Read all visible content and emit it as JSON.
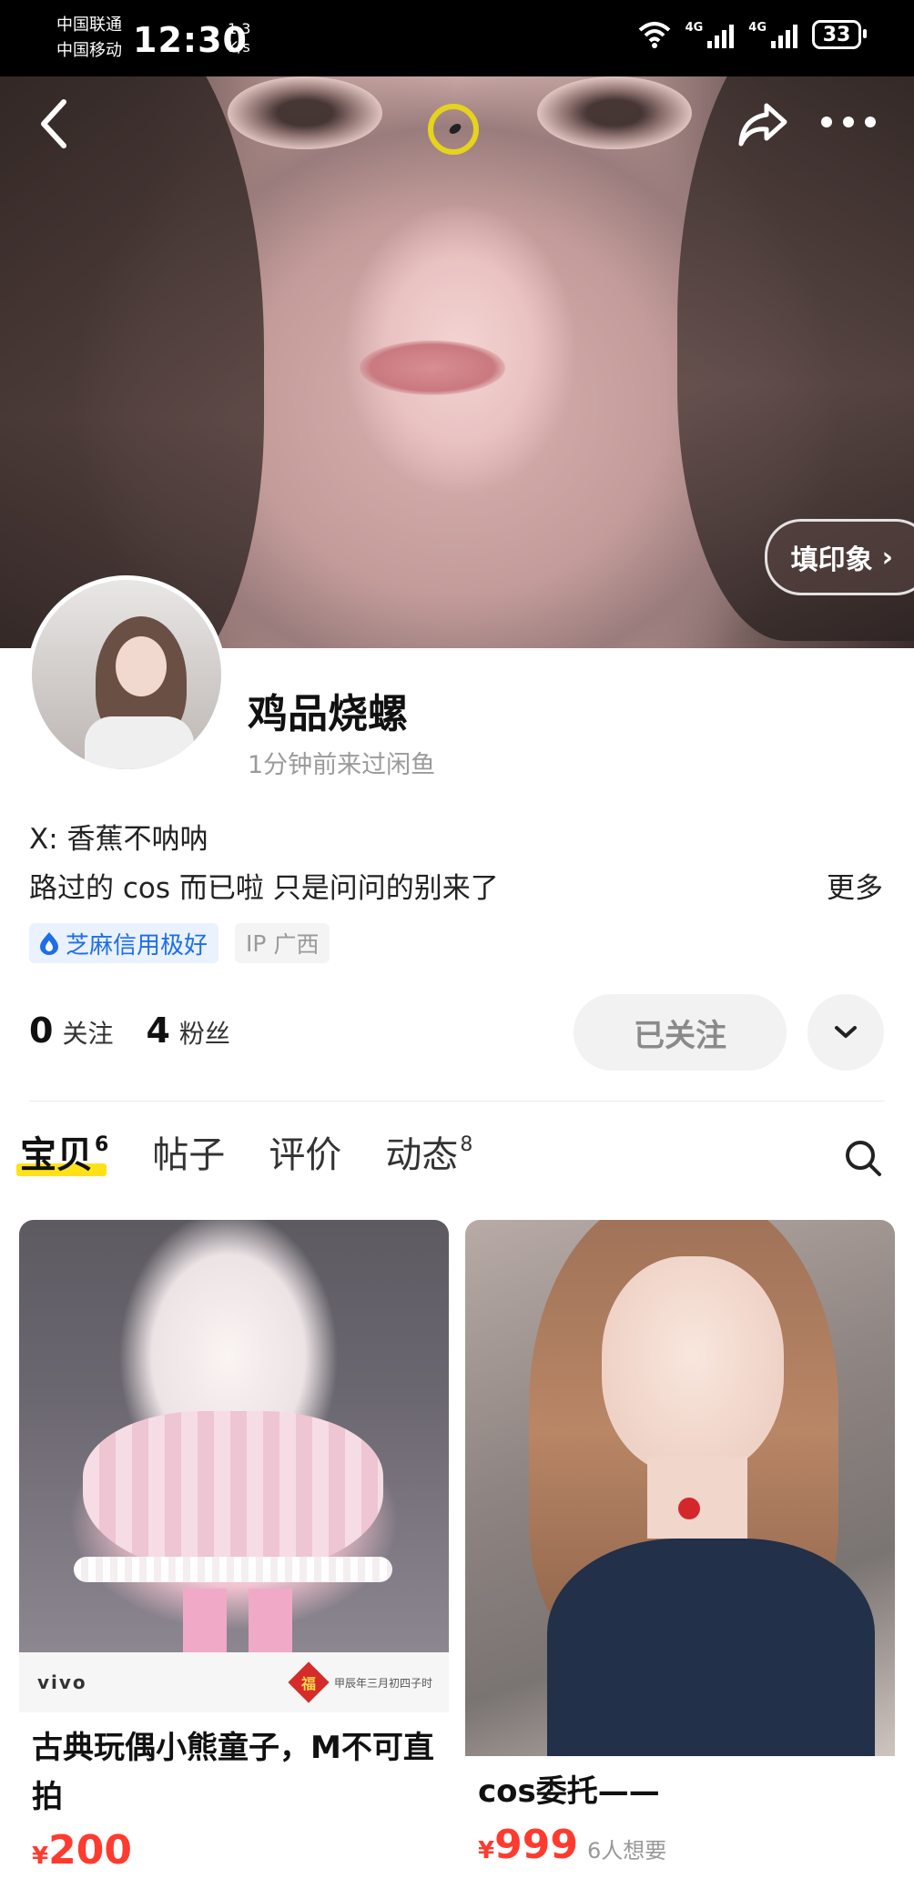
{
  "status_bar": {
    "carrier_1": "中国联通",
    "carrier_2": "中国移动",
    "time": "12:30",
    "speed_value": "1.3",
    "speed_unit": "K/s",
    "net_1": "4G",
    "net_2": "4G",
    "battery": "33"
  },
  "cover": {
    "impression_button": "填印象",
    "impression_chevron": "›"
  },
  "profile": {
    "username": "鸡品烧螺",
    "last_seen": "1分钟前来过闲鱼",
    "bio_line_1": "X: 香蕉不呐呐",
    "bio_line_2": "路过的 cos 而已啦 只是问问的别来了",
    "more": "更多",
    "credit_badge": "芝麻信用极好",
    "ip_label": "IP",
    "ip_region": "广西",
    "following_count": "0",
    "following_label": "关注",
    "followers_count": "4",
    "followers_label": "粉丝",
    "followed_button": "已关注"
  },
  "tabs": [
    {
      "label": "宝贝",
      "count": "6",
      "active": true
    },
    {
      "label": "帖子",
      "count": ""
    },
    {
      "label": "评价",
      "count": ""
    },
    {
      "label": "动态",
      "count": "8"
    }
  ],
  "items": [
    {
      "title": "古典玩偶小熊童子，M不可直拍",
      "currency": "¥",
      "price": "200",
      "wants": "",
      "watermark_brand": "vivo",
      "watermark_seal": "福",
      "watermark_date": "甲辰年三月初四子时"
    },
    {
      "title": "cos委托——",
      "currency": "¥",
      "price": "999",
      "wants": "6人想要"
    }
  ],
  "icons": {
    "back": "back-arrow-icon",
    "share": "share-icon",
    "more": "more-dots-icon",
    "search": "search-icon",
    "dropdown": "chevron-down-icon",
    "credit": "sesame-credit-icon"
  },
  "colors": {
    "accent_yellow": "#ffe118",
    "price_red": "#ff3a2f",
    "credit_blue": "#1f6ee8"
  }
}
